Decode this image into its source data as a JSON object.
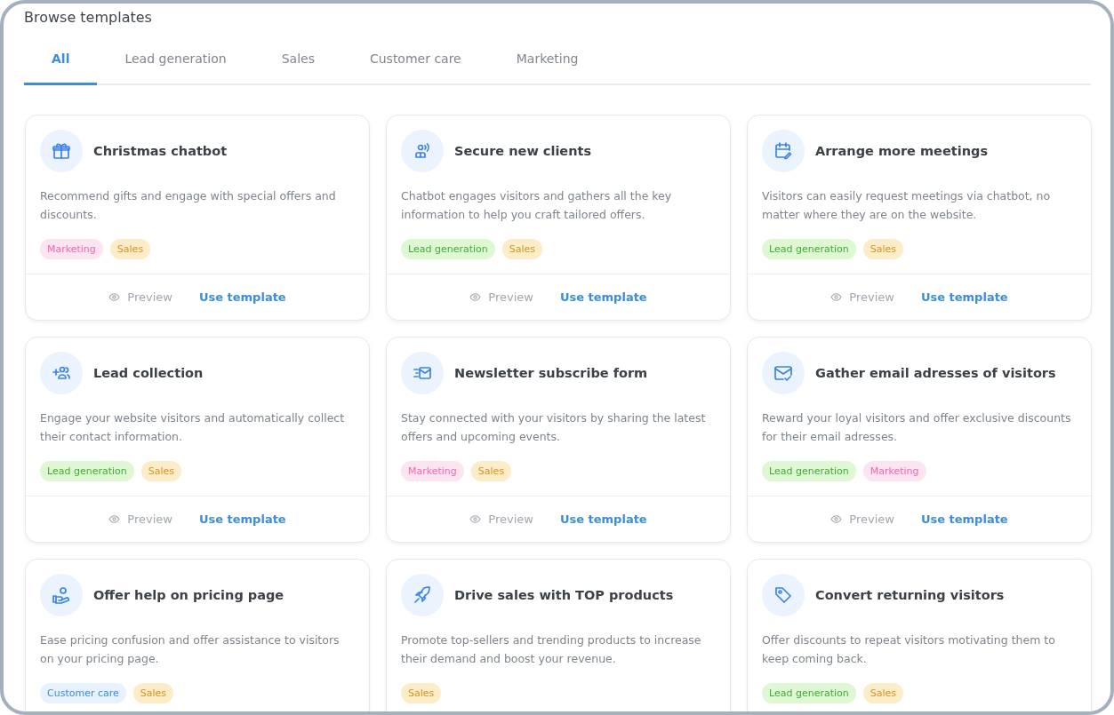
{
  "title": "Browse templates",
  "tabs": [
    {
      "label": "All",
      "selected": true
    },
    {
      "label": "Lead generation",
      "selected": false
    },
    {
      "label": "Sales",
      "selected": false
    },
    {
      "label": "Customer care",
      "selected": false
    },
    {
      "label": "Marketing",
      "selected": false
    }
  ],
  "cards": [
    {
      "title": "Christmas chatbot",
      "description": "Recommend gifts and engage with special offers and discounts.",
      "tags": [
        {
          "label": "Marketing",
          "kind": "marketing"
        },
        {
          "label": "Sales",
          "kind": "sales"
        }
      ],
      "preview": "Preview",
      "use": "Use template"
    },
    {
      "title": "Secure new clients",
      "description": "Chatbot engages visitors and gathers all the key information to help you craft tailored offers.",
      "tags": [
        {
          "label": "Lead generation",
          "kind": "lead"
        },
        {
          "label": "Sales",
          "kind": "sales"
        }
      ],
      "preview": "Preview",
      "use": "Use template"
    },
    {
      "title": "Arrange more meetings",
      "description": "Visitors can easily request meetings via chatbot, no matter where they are on the website.",
      "tags": [
        {
          "label": "Lead generation",
          "kind": "lead"
        },
        {
          "label": "Sales",
          "kind": "sales"
        }
      ],
      "preview": "Preview",
      "use": "Use template"
    },
    {
      "title": "Lead collection",
      "description": "Engage your website visitors and automatically collect their contact information.",
      "tags": [
        {
          "label": "Lead generation",
          "kind": "lead"
        },
        {
          "label": "Sales",
          "kind": "sales"
        }
      ],
      "preview": "Preview",
      "use": "Use template"
    },
    {
      "title": "Newsletter subscribe form",
      "description": "Stay connected with your visitors by sharing the latest offers and upcoming events.",
      "tags": [
        {
          "label": "Marketing",
          "kind": "marketing"
        },
        {
          "label": "Sales",
          "kind": "sales"
        }
      ],
      "preview": "Preview",
      "use": "Use template"
    },
    {
      "title": "Gather email adresses of visitors",
      "description": "Reward your loyal visitors and offer exclusive discounts for their email adresses.",
      "tags": [
        {
          "label": "Lead generation",
          "kind": "lead"
        },
        {
          "label": "Marketing",
          "kind": "marketing"
        }
      ],
      "preview": "Preview",
      "use": "Use template"
    },
    {
      "title": "Offer help on pricing page",
      "description": "Ease pricing confusion and offer assistance to visitors on your pricing page.",
      "tags": [
        {
          "label": "Customer care",
          "kind": "care"
        },
        {
          "label": "Sales",
          "kind": "sales"
        }
      ]
    },
    {
      "title": "Drive sales with TOP products",
      "description": "Promote top-sellers and trending products to increase their demand and boost your revenue.",
      "tags": [
        {
          "label": "Sales",
          "kind": "sales"
        }
      ]
    },
    {
      "title": "Convert returning visitors",
      "description": "Offer discounts to repeat visitors motivating them to keep coming back.",
      "tags": [
        {
          "label": "Lead generation",
          "kind": "lead"
        },
        {
          "label": "Sales",
          "kind": "sales"
        }
      ]
    }
  ]
}
